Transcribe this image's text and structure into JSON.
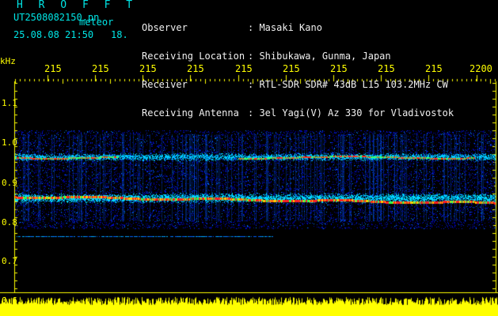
{
  "header": {
    "app_title": "H R O F F T",
    "filename": "UT2508082150.pn",
    "meteor_tag": "meteor",
    "datetime": "25.08.08 21:50",
    "extra": "18."
  },
  "info": {
    "labels": [
      "Observer",
      "Receiving Location",
      "Receiver",
      "Receiving Antenna"
    ],
    "values": [
      ": Masaki Kano",
      ": Shibukawa, Gunma, Japan",
      ": RTL-SDR SDR# 43dB L15 103.2MHz CW",
      ": 3el Yagi(V) Az 330 for Vladivostok"
    ]
  },
  "axis": {
    "unit": "kHz",
    "time_ticks": [
      "215",
      "215",
      "215",
      "215",
      "215",
      "215",
      "215",
      "215",
      "215",
      "2200"
    ],
    "freq_ticks": [
      "1.1",
      "1.0",
      "0.9",
      "0.8",
      "0.7",
      "0.6"
    ]
  },
  "colors": {
    "header_text": "#00e6e6",
    "axis_text": "#ffff00",
    "background": "#000000",
    "noise": "#0000c8",
    "signal": "#ff2020"
  }
}
